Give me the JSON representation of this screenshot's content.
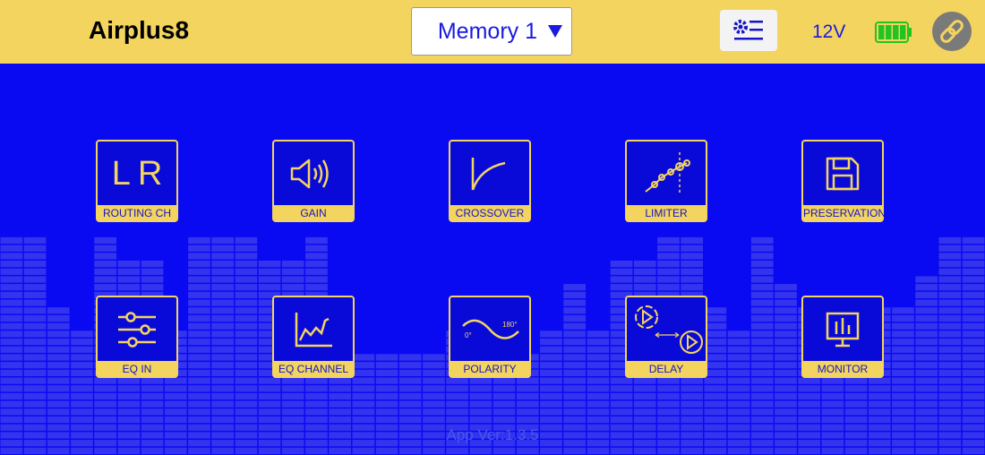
{
  "header": {
    "title": "Airplus8",
    "memory_value": "Memory 1",
    "voltage": "12V",
    "battery_level": 1.0,
    "accent": "#f3d45f",
    "brand_blue": "#0a0af2"
  },
  "tiles": [
    {
      "label": "ROUTING CH",
      "icon": "lr-icon",
      "icon_text": "LR"
    },
    {
      "label": "GAIN",
      "icon": "speaker-icon"
    },
    {
      "label": "CROSSOVER",
      "icon": "crossover-curve-icon"
    },
    {
      "label": "LIMITER",
      "icon": "limiter-curve-icon"
    },
    {
      "label": "PRESERVATION",
      "icon": "save-icon"
    },
    {
      "label": "EQ IN",
      "icon": "sliders-icon"
    },
    {
      "label": "EQ CHANNEL",
      "icon": "eq-graph-icon"
    },
    {
      "label": "POLARITY",
      "icon": "phase-wave-icon",
      "deg_start": "0°",
      "deg_end": "180°"
    },
    {
      "label": "DELAY",
      "icon": "delay-play-icon"
    },
    {
      "label": "MONITOR",
      "icon": "monitor-icon"
    }
  ],
  "footer": {
    "version": "App Ver:1.3.5"
  }
}
